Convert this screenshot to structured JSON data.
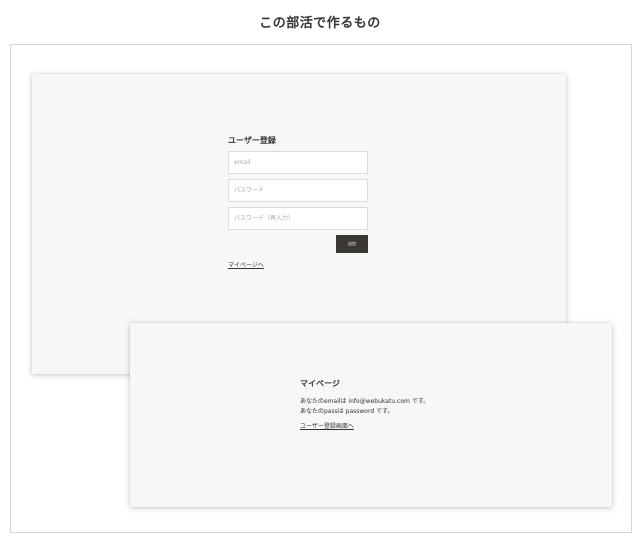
{
  "page": {
    "heading": "この部活で作るもの"
  },
  "register": {
    "title": "ユーザー登録",
    "email_placeholder": "email",
    "password_placeholder": "パスワード",
    "password_confirm_placeholder": "パスワード（再入力）",
    "submit_label": "送信",
    "mypage_link": "マイページへ"
  },
  "mypage": {
    "title": "マイページ",
    "email_line": "あなたのemailは info@webukatu.com です。",
    "pass_line": "あなたのpassは password です。",
    "register_link": "ユーザー登録画面へ"
  },
  "colors": {
    "card_background": "#f7f7f5",
    "button_background": "#3a3735",
    "text": "#333333"
  }
}
